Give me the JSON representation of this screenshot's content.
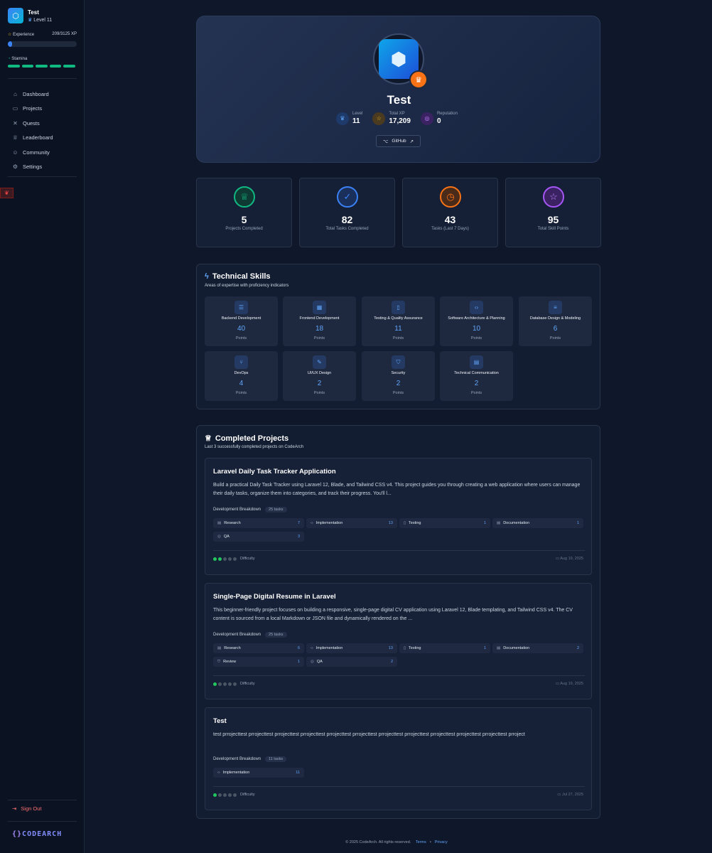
{
  "user": {
    "name": "Test",
    "level_label": "Level 11"
  },
  "experience": {
    "label": "Experience",
    "value": "209/3125 XP",
    "progress": 0.067
  },
  "stamina": {
    "label": "Stamina"
  },
  "nav": [
    {
      "label": "Dashboard",
      "icon": "home-icon"
    },
    {
      "label": "Projects",
      "icon": "folder-icon"
    },
    {
      "label": "Quests",
      "icon": "swords-icon"
    },
    {
      "label": "Leaderboard",
      "icon": "trophy-icon"
    },
    {
      "label": "Community",
      "icon": "users-icon"
    },
    {
      "label": "Settings",
      "icon": "gear-icon"
    }
  ],
  "sign_out": "Sign Out",
  "brand": {
    "prefix": "{}",
    "name": "CODEARCH"
  },
  "profile": {
    "name": "Test",
    "stats": [
      {
        "label": "Level",
        "value": "11"
      },
      {
        "label": "Total XP",
        "value": "17,209"
      },
      {
        "label": "Reputation",
        "value": "0"
      }
    ],
    "github": "GitHub"
  },
  "stat_cards": [
    {
      "value": "5",
      "label": "Projects Completed",
      "color": "#10b981"
    },
    {
      "value": "82",
      "label": "Total Tasks Completed",
      "color": "#3b82f6"
    },
    {
      "value": "43",
      "label": "Tasks (Last 7 Days)",
      "color": "#f97316"
    },
    {
      "value": "95",
      "label": "Total Skill Points",
      "color": "#a855f7"
    }
  ],
  "skills_panel": {
    "title": "Technical Skills",
    "subtitle": "Areas of expertise with proficiency indicators",
    "unit": "Points",
    "skills": [
      {
        "name": "Backend Development",
        "value": "40"
      },
      {
        "name": "Frontend Development",
        "value": "18"
      },
      {
        "name": "Testing & Quality Assurance",
        "value": "11"
      },
      {
        "name": "Software Architecture & Planning",
        "value": "10"
      },
      {
        "name": "Database Design & Modeling",
        "value": "6"
      },
      {
        "name": "DevOps",
        "value": "4"
      },
      {
        "name": "UI/UX Design",
        "value": "2"
      },
      {
        "name": "Security",
        "value": "2"
      },
      {
        "name": "Technical Communication",
        "value": "2"
      }
    ]
  },
  "projects_panel": {
    "title": "Completed Projects",
    "subtitle": "Last 3 successfully completed projects on CodeArch",
    "breakdown_label": "Development Breakdown",
    "difficulty_label": "Difficulty",
    "projects": [
      {
        "title": "Laravel Daily Task Tracker Application",
        "desc": "Build a practical Daily Task Tracker using Laravel 12, Blade, and Tailwind CSS v4. This project guides you through creating a web application where users can manage their daily tasks, organize them into categories, and track their progress. You'll l...",
        "tasks": "25 tasks",
        "chips": [
          {
            "label": "Research",
            "count": "7"
          },
          {
            "label": "Implementation",
            "count": "13"
          },
          {
            "label": "Testing",
            "count": "1"
          },
          {
            "label": "Documentation",
            "count": "1"
          },
          {
            "label": "QA",
            "count": "3"
          }
        ],
        "difficulty": 2,
        "date": "Aug 19, 2025"
      },
      {
        "title": "Single-Page Digital Resume in Laravel",
        "desc": "This beginner-friendly project focuses on building a responsive, single-page digital CV application using Laravel 12, Blade templating, and Tailwind CSS v4. The CV content is sourced from a local Markdown or JSON file and dynamically rendered on the ...",
        "tasks": "25 tasks",
        "chips": [
          {
            "label": "Research",
            "count": "6"
          },
          {
            "label": "Implementation",
            "count": "13"
          },
          {
            "label": "Testing",
            "count": "1"
          },
          {
            "label": "Documentation",
            "count": "2"
          },
          {
            "label": "Review",
            "count": "1"
          },
          {
            "label": "QA",
            "count": "2"
          }
        ],
        "difficulty": 1,
        "date": "Aug 19, 2025"
      },
      {
        "title": "Test",
        "desc": "test prrojecttest prrojecttest prrojecttest prrojecttest prrojecttest prrojecttest prrojecttest prrojecttest prrojecttest prrojecttest prrojecttest prroject",
        "tasks": "11 tasks",
        "chips": [
          {
            "label": "Implementation",
            "count": "11"
          }
        ],
        "difficulty": 1,
        "date": "Jul 27, 2025"
      }
    ]
  },
  "footer": {
    "copyright": "© 2025 CodeArch. All rights reserved.",
    "terms": "Terms",
    "separator": "•",
    "privacy": "Privacy"
  }
}
